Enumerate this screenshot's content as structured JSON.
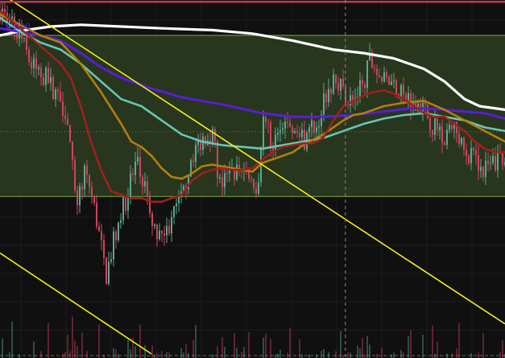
{
  "colors": {
    "background": "#101010",
    "grid": "#1d1d1d",
    "zone_fill": "#2b3d20",
    "zone_border": "#7da848",
    "up": "#5aa992",
    "down": "#d0435e",
    "trendline": "#f2ee1a",
    "top_line": "#c0384f",
    "crosshair": "#8a8a8a",
    "sma_white": "#ffffff",
    "sma_purple": "#5a1dd6",
    "sma_teal": "#6ac6b2",
    "sma_orange": "#b57e0c",
    "sma_red": "#a01f1f",
    "price_marker": "#5a1dd6",
    "dotted_orange": "#c0572a"
  },
  "overlay": {
    "price_label": "$ 0.00",
    "price_label_color": "#5a1dd6"
  },
  "chart_data": {
    "type": "candlestick",
    "title": "",
    "xlabel": "",
    "ylabel": "",
    "ylim": [
      0,
      100
    ],
    "grid": true,
    "zone": {
      "upper": 90,
      "lower": 44.5
    },
    "reference_lines": [
      {
        "name": "",
        "value": 99.5
      },
      {
        "name": "",
        "value": 62.8
      }
    ],
    "trendlines": [
      {
        "from": [
          0,
          102
        ],
        "to": [
          100,
          8.5
        ]
      },
      {
        "from": [
          0,
          28.5
        ],
        "to": [
          30,
          0
        ]
      }
    ],
    "crosshair_x": 68.4,
    "price_keyframes": [
      [
        0,
        97
      ],
      [
        4,
        90
      ],
      [
        6,
        82
      ],
      [
        9,
        78
      ],
      [
        12,
        72
      ],
      [
        13.5,
        66
      ],
      [
        15,
        42
      ],
      [
        17,
        52
      ],
      [
        19,
        39
      ],
      [
        21,
        22
      ],
      [
        23,
        35
      ],
      [
        25,
        44
      ],
      [
        27,
        54
      ],
      [
        28.5,
        48
      ],
      [
        30,
        36
      ],
      [
        31.5,
        32
      ],
      [
        34,
        38
      ],
      [
        36,
        44
      ],
      [
        38,
        56
      ],
      [
        40,
        61
      ],
      [
        42,
        63
      ],
      [
        43.5,
        48
      ],
      [
        46,
        51
      ],
      [
        49,
        52
      ],
      [
        51,
        47
      ],
      [
        52,
        67
      ],
      [
        54,
        59
      ],
      [
        56,
        63
      ],
      [
        58,
        65
      ],
      [
        60,
        60
      ],
      [
        63,
        66
      ],
      [
        65,
        75
      ],
      [
        67,
        77
      ],
      [
        68.5,
        73
      ],
      [
        70,
        71
      ],
      [
        72,
        77
      ],
      [
        73.5,
        84
      ],
      [
        75,
        78
      ],
      [
        78,
        76
      ],
      [
        80,
        72
      ],
      [
        82,
        72
      ],
      [
        84,
        69
      ],
      [
        86,
        64
      ],
      [
        88,
        62
      ],
      [
        90,
        63
      ],
      [
        92,
        57
      ],
      [
        94,
        55
      ],
      [
        96,
        52
      ],
      [
        98,
        54
      ],
      [
        100,
        57
      ]
    ],
    "sma": [
      {
        "name": "",
        "color": "#ffffff",
        "points": [
          [
            0,
            90
          ],
          [
            5,
            91.5
          ],
          [
            10,
            92.5
          ],
          [
            16,
            93
          ],
          [
            24,
            92.5
          ],
          [
            32,
            92
          ],
          [
            42,
            91.5
          ],
          [
            50,
            90.5
          ],
          [
            58,
            88.5
          ],
          [
            66,
            86
          ],
          [
            72,
            85
          ],
          [
            78,
            83.5
          ],
          [
            84,
            80.5
          ],
          [
            88,
            77
          ],
          [
            92,
            72
          ],
          [
            95,
            70
          ],
          [
            100,
            69
          ]
        ]
      },
      {
        "name": "",
        "color": "#5a1dd6",
        "points": [
          [
            0,
            92
          ],
          [
            4,
            91
          ],
          [
            8,
            90
          ],
          [
            12,
            88.5
          ],
          [
            16,
            85
          ],
          [
            20,
            81
          ],
          [
            24,
            78
          ],
          [
            30,
            75
          ],
          [
            36,
            72.5
          ],
          [
            44,
            70.5
          ],
          [
            52,
            68
          ],
          [
            58,
            67
          ],
          [
            64,
            67
          ],
          [
            70,
            67.5
          ],
          [
            76,
            68.5
          ],
          [
            82,
            69.5
          ],
          [
            88,
            69
          ],
          [
            92,
            68.5
          ],
          [
            96,
            68
          ],
          [
            100,
            66.5
          ]
        ]
      },
      {
        "name": "",
        "color": "#6ac6b2",
        "points": [
          [
            0,
            95
          ],
          [
            4,
            91
          ],
          [
            8,
            88
          ],
          [
            12,
            86
          ],
          [
            16,
            82
          ],
          [
            20,
            77
          ],
          [
            24,
            72
          ],
          [
            28,
            70
          ],
          [
            32,
            66
          ],
          [
            36,
            62
          ],
          [
            40,
            60
          ],
          [
            44,
            59
          ],
          [
            48,
            58.5
          ],
          [
            52,
            58
          ],
          [
            56,
            59
          ],
          [
            60,
            60
          ],
          [
            64,
            61
          ],
          [
            68,
            63
          ],
          [
            72,
            65
          ],
          [
            76,
            66.5
          ],
          [
            80,
            67.5
          ],
          [
            84,
            68
          ],
          [
            88,
            67
          ],
          [
            92,
            66
          ],
          [
            96,
            64
          ],
          [
            100,
            63
          ]
        ]
      },
      {
        "name": "",
        "color": "#b57e0c",
        "points": [
          [
            0,
            96
          ],
          [
            4,
            93
          ],
          [
            8,
            90
          ],
          [
            12,
            88
          ],
          [
            16,
            82
          ],
          [
            20,
            74
          ],
          [
            24,
            65
          ],
          [
            26,
            60
          ],
          [
            28,
            58.5
          ],
          [
            30,
            56
          ],
          [
            32,
            52.5
          ],
          [
            34,
            50
          ],
          [
            36,
            49.5
          ],
          [
            38,
            51
          ],
          [
            40,
            53
          ],
          [
            42,
            53.5
          ],
          [
            44,
            53
          ],
          [
            46,
            52.5
          ],
          [
            48,
            52
          ],
          [
            50,
            51.5
          ],
          [
            52,
            54
          ],
          [
            54,
            55
          ],
          [
            56,
            56
          ],
          [
            58,
            57
          ],
          [
            60,
            59
          ],
          [
            62,
            60.5
          ],
          [
            64,
            62
          ],
          [
            66,
            64
          ],
          [
            68,
            66
          ],
          [
            70,
            67.5
          ],
          [
            72,
            68
          ],
          [
            76,
            70
          ],
          [
            80,
            71
          ],
          [
            84,
            71.5
          ],
          [
            88,
            69
          ],
          [
            92,
            66
          ],
          [
            96,
            63
          ],
          [
            100,
            60
          ]
        ]
      },
      {
        "name": "",
        "color": "#a01f1f",
        "points": [
          [
            0,
            97
          ],
          [
            4,
            92
          ],
          [
            8,
            87
          ],
          [
            12,
            82
          ],
          [
            14,
            78
          ],
          [
            16,
            70
          ],
          [
            18,
            60
          ],
          [
            20,
            52
          ],
          [
            22,
            46
          ],
          [
            24,
            45
          ],
          [
            26,
            44
          ],
          [
            28,
            44
          ],
          [
            30,
            43
          ],
          [
            32,
            43
          ],
          [
            34,
            44
          ],
          [
            36,
            45
          ],
          [
            38,
            49
          ],
          [
            40,
            51
          ],
          [
            42,
            52
          ],
          [
            44,
            52.5
          ],
          [
            46,
            52
          ],
          [
            48,
            52
          ],
          [
            50,
            52.5
          ],
          [
            52,
            55
          ],
          [
            54,
            57
          ],
          [
            56,
            58.5
          ],
          [
            58,
            59
          ],
          [
            60,
            59.5
          ],
          [
            62,
            59.5
          ],
          [
            64,
            61
          ],
          [
            66,
            66
          ],
          [
            68,
            70
          ],
          [
            70,
            71.5
          ],
          [
            72,
            73
          ],
          [
            74,
            74
          ],
          [
            76,
            74.5
          ],
          [
            78,
            73.5
          ],
          [
            80,
            72
          ],
          [
            82,
            70
          ],
          [
            84,
            68
          ],
          [
            86,
            67
          ],
          [
            88,
            67
          ],
          [
            90,
            65
          ],
          [
            92,
            63
          ],
          [
            94,
            60
          ],
          [
            96,
            58
          ],
          [
            98,
            57
          ],
          [
            100,
            57
          ]
        ]
      }
    ]
  }
}
